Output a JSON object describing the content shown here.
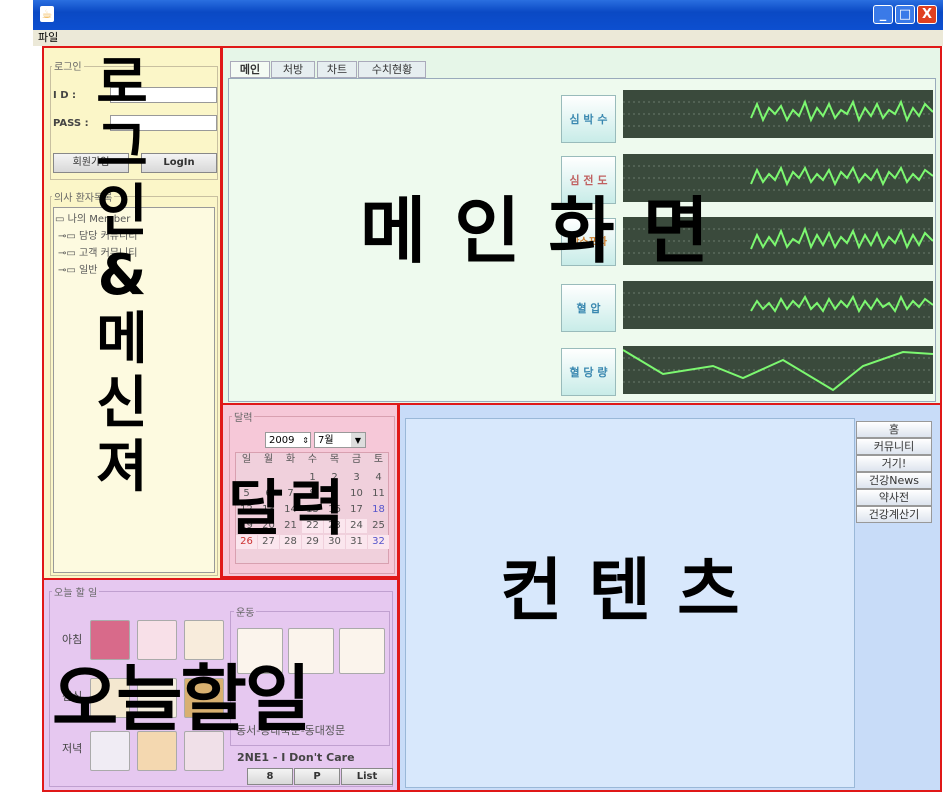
{
  "window": {
    "menu_file": "파일",
    "btn_min": "_",
    "btn_max": "□",
    "btn_close": "X"
  },
  "login": {
    "legend": "로그인",
    "id_label": "I   D :",
    "pass_label": "PASS :",
    "join_btn": "회원가입",
    "login_btn": "LogIn"
  },
  "messenger": {
    "legend": "의사 환자목록",
    "tree": [
      "나의 Member",
      "담당 커뮤니티",
      "고객 커뮤니티",
      "일반"
    ]
  },
  "overlay": {
    "login_messenger": "로그인&메신져",
    "main_screen": "메인화면",
    "calendar": "달력",
    "contents": "컨텐츠",
    "todo": "오늘할일"
  },
  "main": {
    "tabs": [
      "메인",
      "처방",
      "차트",
      "수치현황"
    ],
    "vitals": [
      {
        "label": "심 박 수"
      },
      {
        "label": "심 전 도"
      },
      {
        "label": "산소포화"
      },
      {
        "label": "혈   압"
      },
      {
        "label": "혈 당 량"
      }
    ]
  },
  "calendar": {
    "legend": "달력",
    "year": "2009",
    "month": "7월",
    "weekdays": [
      "일",
      "월",
      "화",
      "수",
      "목",
      "금",
      "토"
    ],
    "rows": [
      [
        "",
        "",
        "",
        "1",
        "2",
        "3",
        "4"
      ],
      [
        "5",
        "6",
        "7",
        "8",
        "9",
        "10",
        "11"
      ],
      [
        "12",
        "13",
        "14",
        "15",
        "16",
        "17",
        "18"
      ],
      [
        "19",
        "20",
        "21",
        "22",
        "23",
        "24",
        "25"
      ],
      [
        "26",
        "27",
        "28",
        "29",
        "30",
        "31",
        "32"
      ]
    ]
  },
  "contents": {
    "nav": [
      "홈",
      "커뮤니티",
      "거기!",
      "건강News",
      "약사전",
      "건강계산기"
    ]
  },
  "todo": {
    "legend": "오늘 할 일",
    "meals": [
      "아침",
      "점심",
      "저녁"
    ],
    "exercise_legend": "운동",
    "exercise_text": "동서-동대북문-동대정문",
    "music_label": "2NE1 - I Don't Care",
    "music_buttons": [
      "8",
      "P",
      "List"
    ]
  },
  "colors": {
    "frame": "#e01818",
    "login_bg": "#fbf6c8",
    "main_bg": "#e6f6e8",
    "calendar_bg": "#f6c8d8",
    "contents_bg": "#c8dcf8",
    "todo_bg": "#e6c8f0",
    "scope_bg": "#3a4a3c",
    "wave": "#7cf870"
  }
}
